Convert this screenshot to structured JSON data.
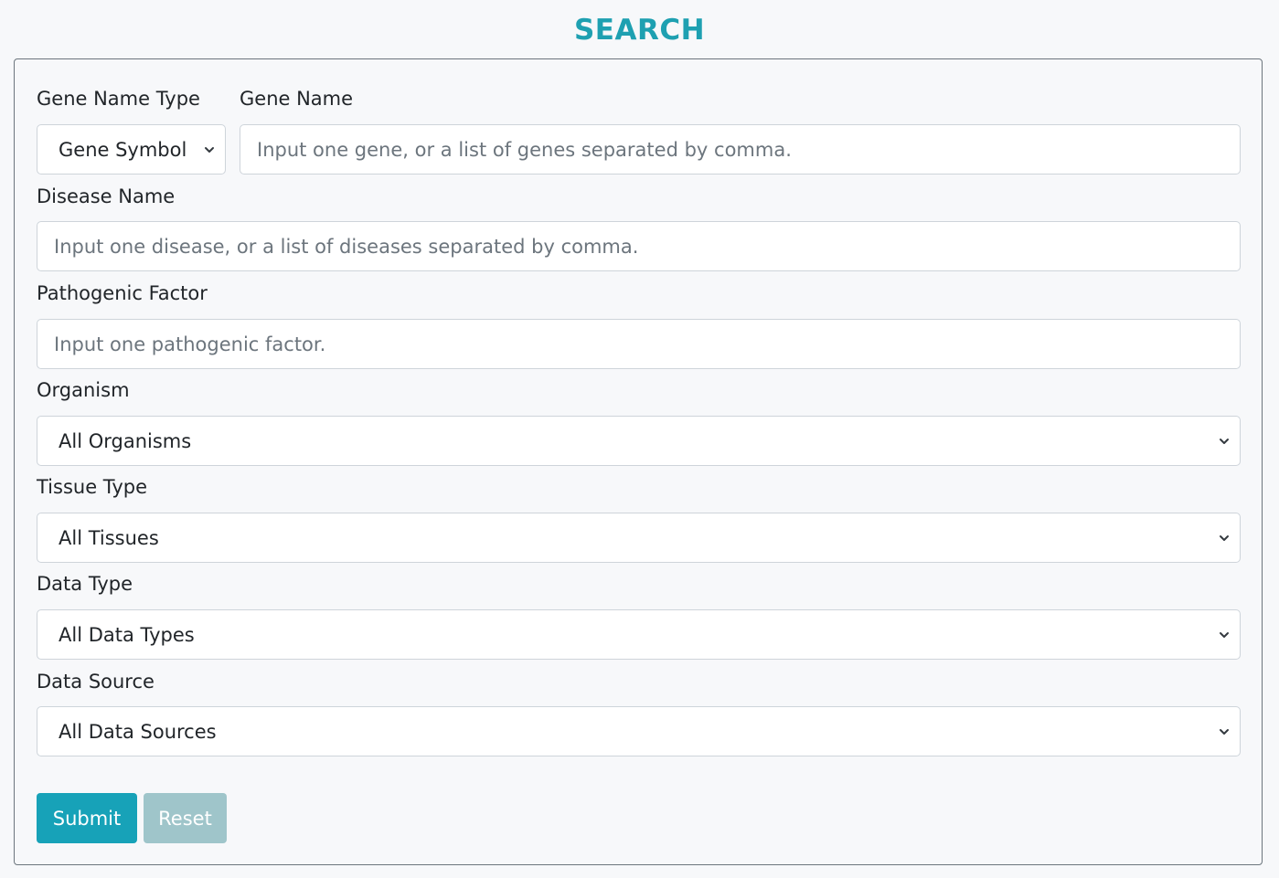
{
  "page": {
    "title": "SEARCH"
  },
  "form": {
    "gene_name_type": {
      "label": "Gene Name Type",
      "selected": "Gene Symbol"
    },
    "gene_name": {
      "label": "Gene Name",
      "placeholder": "Input one gene, or a list of genes separated by comma.",
      "value": ""
    },
    "disease_name": {
      "label": "Disease Name",
      "placeholder": "Input one disease, or a list of diseases separated by comma.",
      "value": ""
    },
    "pathogenic_factor": {
      "label": "Pathogenic Factor",
      "placeholder": "Input one pathogenic factor.",
      "value": ""
    },
    "organism": {
      "label": "Organism",
      "selected": "All Organisms"
    },
    "tissue_type": {
      "label": "Tissue Type",
      "selected": "All Tissues"
    },
    "data_type": {
      "label": "Data Type",
      "selected": "All Data Types"
    },
    "data_source": {
      "label": "Data Source",
      "selected": "All Data Sources"
    }
  },
  "buttons": {
    "submit_label": "Submit",
    "reset_label": "Reset"
  },
  "colors": {
    "accent": "#1ea0b1",
    "submit_bg": "#17a2b8",
    "reset_bg": "#9fc5ca",
    "border": "#ced4da",
    "card_border": "#6c757d",
    "placeholder": "#6c757d"
  },
  "icons": {
    "select_arrow": "chevron-down-icon"
  }
}
